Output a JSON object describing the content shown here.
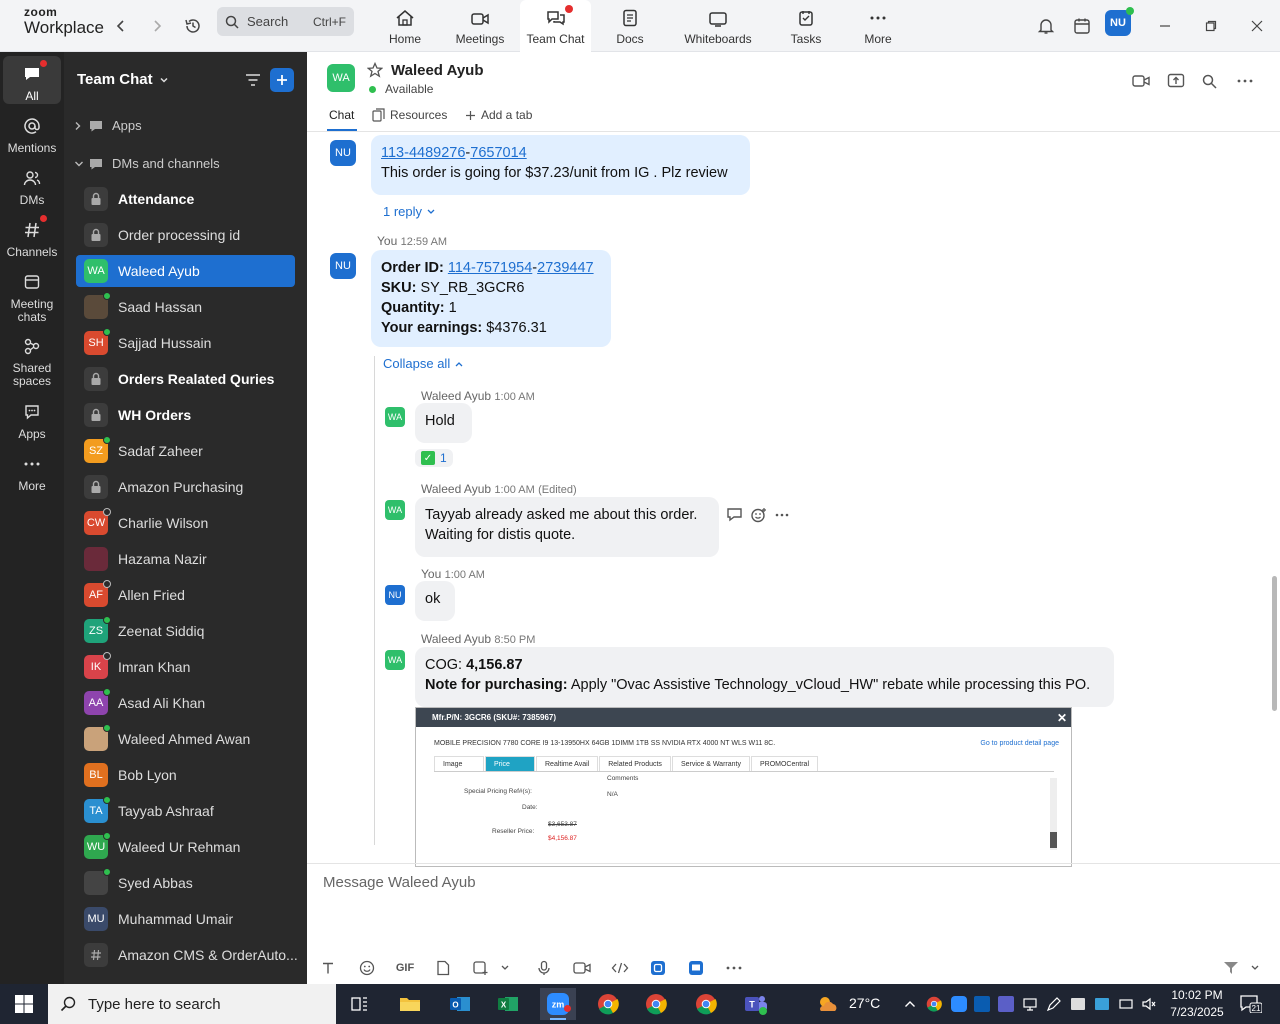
{
  "app": {
    "brand_top": "zoom",
    "brand_bottom": "Workplace"
  },
  "search": {
    "label": "Search",
    "shortcut": "Ctrl+F"
  },
  "nav_tabs": [
    {
      "label": "Home",
      "icon": "home-icon"
    },
    {
      "label": "Meetings",
      "icon": "video-camera-icon"
    },
    {
      "label": "Team Chat",
      "icon": "chat-bubbles-icon",
      "active": true
    },
    {
      "label": "Docs",
      "icon": "document-icon"
    },
    {
      "label": "Whiteboards",
      "icon": "whiteboard-icon"
    },
    {
      "label": "Tasks",
      "icon": "tasks-icon"
    },
    {
      "label": "More",
      "icon": "more-dots-icon"
    }
  ],
  "user_avatar": "NU",
  "rail": [
    {
      "label": "All",
      "icon": "chat-icon"
    },
    {
      "label": "Mentions",
      "icon": "at-icon"
    },
    {
      "label": "DMs",
      "icon": "people-icon"
    },
    {
      "label": "Channels",
      "icon": "hash-icon"
    },
    {
      "label": "Meeting chats",
      "icon": "calendar-chat-icon"
    },
    {
      "label": "Shared spaces",
      "icon": "shared-spaces-icon"
    },
    {
      "label": "Apps",
      "icon": "apps-icon"
    },
    {
      "label": "More",
      "icon": "more-dots-icon"
    }
  ],
  "sidebar": {
    "title": "Team Chat",
    "sections": {
      "apps": "Apps",
      "dms": "DMs and channels"
    },
    "items": [
      {
        "name": "Attendance",
        "type": "lock",
        "bold": true
      },
      {
        "name": "Order processing id",
        "type": "lock"
      },
      {
        "name": "Waleed Ayub",
        "initials": "WA",
        "color": "#2fbf6b",
        "active": true
      },
      {
        "name": "Saad Hassan",
        "initials": "",
        "color": "#5a4a3a",
        "status": "on"
      },
      {
        "name": "Sajjad Hussain",
        "initials": "SH",
        "color": "#d94a2f",
        "status": "on"
      },
      {
        "name": "Orders Realated Quries",
        "type": "lock",
        "bold": true
      },
      {
        "name": "WH Orders",
        "type": "lock",
        "bold": true
      },
      {
        "name": "Sadaf Zaheer",
        "initials": "SZ",
        "color": "#f39c1f",
        "status": "on"
      },
      {
        "name": "Amazon Purchasing",
        "type": "lock"
      },
      {
        "name": "Charlie Wilson",
        "initials": "CW",
        "color": "#d94a2f",
        "status": "off"
      },
      {
        "name": "Hazama Nazir",
        "initials": "",
        "color": "#6a2a3a"
      },
      {
        "name": "Allen Fried",
        "initials": "AF",
        "color": "#d94a2f",
        "status": "off"
      },
      {
        "name": "Zeenat Siddiq",
        "initials": "ZS",
        "color": "#1fa37a",
        "status": "on"
      },
      {
        "name": "Imran Khan",
        "initials": "IK",
        "color": "#d9434a",
        "status": "off"
      },
      {
        "name": "Asad Ali Khan",
        "initials": "AA",
        "color": "#8e44ad",
        "status": "on"
      },
      {
        "name": "Waleed Ahmed Awan",
        "initials": "",
        "color": "#c9a27a",
        "status": "on"
      },
      {
        "name": "Bob Lyon",
        "initials": "BL",
        "color": "#e0701f"
      },
      {
        "name": "Tayyab Ashraaf",
        "initials": "TA",
        "color": "#2a8fd0",
        "status": "on"
      },
      {
        "name": "Waleed Ur Rehman",
        "initials": "WU",
        "color": "#2fa84f",
        "status": "on"
      },
      {
        "name": "Syed Abbas",
        "initials": "",
        "color": "#444",
        "status": "on"
      },
      {
        "name": "Muhammad Umair",
        "initials": "MU",
        "color": "#3a4a6a"
      },
      {
        "name": "Amazon CMS & OrderAuto...",
        "type": "hash"
      }
    ]
  },
  "channel": {
    "initials": "WA",
    "name": "Waleed Ayub",
    "status": "Available",
    "tabs": [
      "Chat",
      "Resources",
      "Add a tab"
    ]
  },
  "messages": {
    "m1": {
      "avatar": "NU",
      "link1": "113-4489276",
      "dash": "-",
      "link2": "7657014",
      "text": "This order is going for $37.23/unit from IG . Plz review",
      "reply": "1 reply"
    },
    "m2": {
      "avatar": "NU",
      "sender": "You",
      "time": "12:59 AM",
      "order_label": "Order ID:",
      "order_link1": "114-7571954",
      "order_dash": "-",
      "order_link2": "2739447",
      "sku_label": "SKU:",
      "sku": "SY_RB_3GCR6",
      "qty_label": "Quantity:",
      "qty": "1",
      "earn_label": "Your earnings:",
      "earn": "$4376.31",
      "collapse": "Collapse all"
    },
    "r1": {
      "avatar": "WA",
      "sender": "Waleed Ayub",
      "time": "1:00 AM",
      "text": "Hold",
      "reaction_count": "1"
    },
    "r2": {
      "avatar": "WA",
      "sender": "Waleed Ayub",
      "time": "1:00 AM",
      "edited": "(Edited)",
      "line1": "Tayyab already asked me about this order.",
      "line2": "Waiting for distis quote."
    },
    "r3": {
      "avatar": "NU",
      "sender": "You",
      "time": "1:00 AM",
      "text": "ok"
    },
    "r4": {
      "avatar": "WA",
      "sender": "Waleed Ayub",
      "time": "8:50 PM",
      "cog_label": "COG:",
      "cog": "4,156.87",
      "note_label": "Note for purchasing:",
      "note": "Apply \"Ovac Assistive Technology_vCloud_HW\" rebate while processing this PO."
    }
  },
  "shot": {
    "title": "Mfr.P/N: 3GCR6 (SKU#: 7385967)",
    "desc": "MOBILE PRECISION 7780 CORE I9 13-13950HX 64GB 1DIMM 1TB SS NVIDIA RTX 4000 NT WLS W11 8C.",
    "link": "Go to product detail page",
    "tabs": [
      "Image",
      "Price",
      "Realtime Avail",
      "Related Products",
      "Service & Warranty",
      "PROMOCentral"
    ],
    "comments": "Comments",
    "spr": "Special Pricing Ref#(s):",
    "na": "N/A",
    "date": "Date:",
    "reseller": "Reseller Price:",
    "old_price": "$3,653.87",
    "new_price": "$4,156.87"
  },
  "composer": {
    "placeholder": "Message Waleed Ayub",
    "gif": "GIF"
  },
  "taskbar": {
    "search": "Type here to search",
    "temp": "27°C",
    "time": "10:02 PM",
    "date": "7/23/2025",
    "notif": "21"
  },
  "colors": {
    "accent": "#1e6fd0",
    "online": "#2fbf4f",
    "bubble": "#e1efff"
  }
}
